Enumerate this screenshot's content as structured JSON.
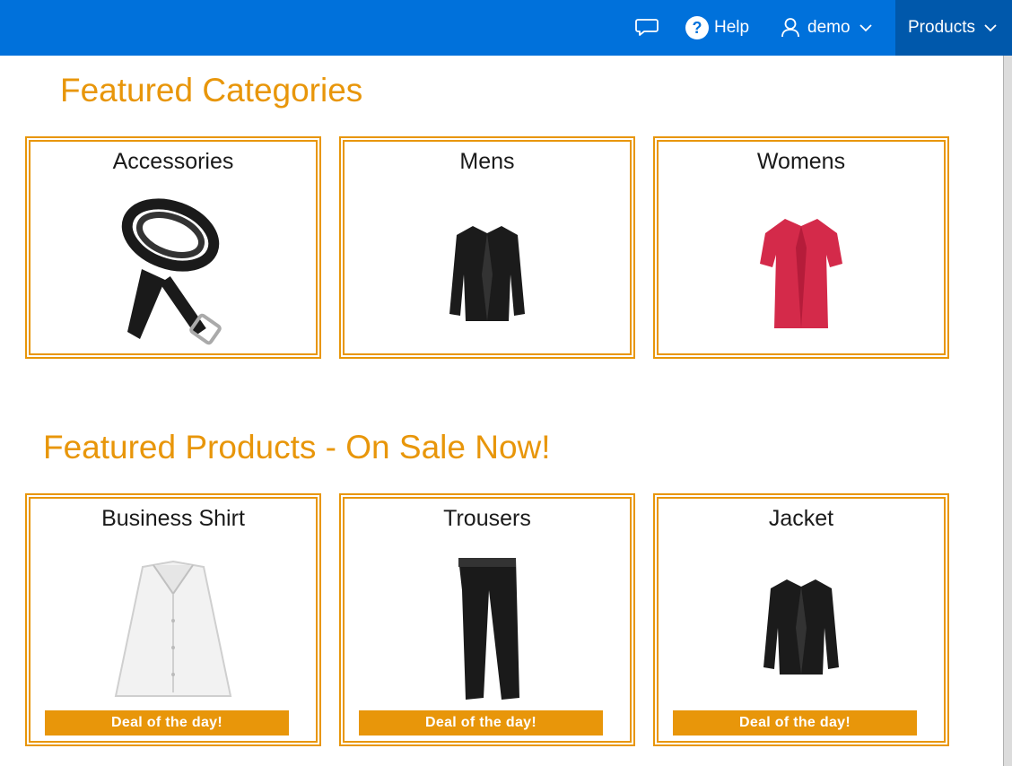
{
  "header": {
    "chat_icon": "chat-bubble-icon",
    "help_label": "Help",
    "user_label": "demo",
    "products_label": "Products",
    "bar_color": "#0071db",
    "active_color": "#0058ab"
  },
  "featured_categories": {
    "title": "Featured Categories",
    "items": [
      {
        "label": "Accessories",
        "image": "belt"
      },
      {
        "label": "Mens",
        "image": "black-jacket"
      },
      {
        "label": "Womens",
        "image": "red-blouse"
      }
    ]
  },
  "featured_products": {
    "title": "Featured Products - On Sale Now!",
    "items": [
      {
        "label": "Business Shirt",
        "image": "white-shirt",
        "badge": "Deal of the day!"
      },
      {
        "label": "Trousers",
        "image": "black-trousers",
        "badge": "Deal of the day!"
      },
      {
        "label": "Jacket",
        "image": "black-jacket",
        "badge": "Deal of the day!"
      }
    ]
  },
  "accent_color": "#e8960a"
}
